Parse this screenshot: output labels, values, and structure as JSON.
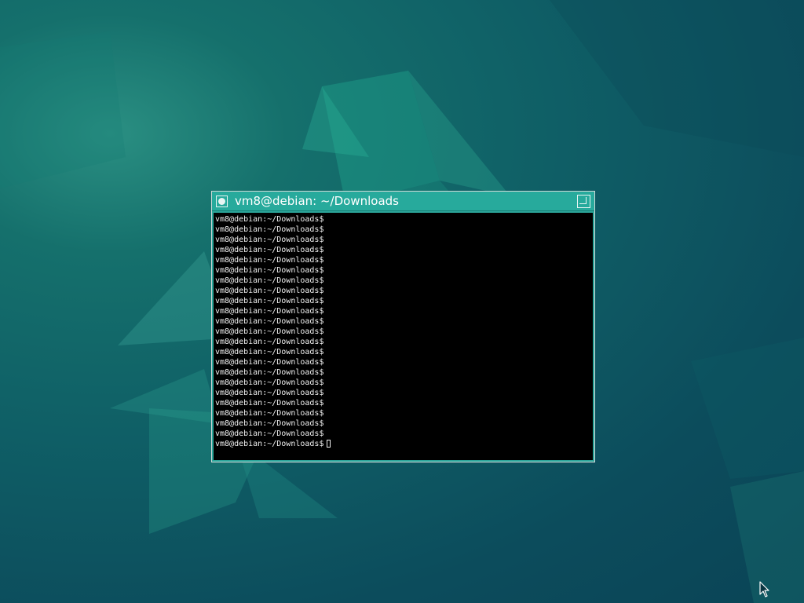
{
  "window": {
    "title": "vm8@debian: ~/Downloads"
  },
  "terminal": {
    "lines": [
      "vm8@debian:~/Downloads$",
      "vm8@debian:~/Downloads$",
      "vm8@debian:~/Downloads$",
      "vm8@debian:~/Downloads$",
      "vm8@debian:~/Downloads$",
      "vm8@debian:~/Downloads$",
      "vm8@debian:~/Downloads$",
      "vm8@debian:~/Downloads$",
      "vm8@debian:~/Downloads$",
      "vm8@debian:~/Downloads$",
      "vm8@debian:~/Downloads$",
      "vm8@debian:~/Downloads$",
      "vm8@debian:~/Downloads$",
      "vm8@debian:~/Downloads$",
      "vm8@debian:~/Downloads$",
      "vm8@debian:~/Downloads$",
      "vm8@debian:~/Downloads$",
      "vm8@debian:~/Downloads$",
      "vm8@debian:~/Downloads$",
      "vm8@debian:~/Downloads$",
      "vm8@debian:~/Downloads$",
      "vm8@debian:~/Downloads$"
    ],
    "prompt": "vm8@debian:~/Downloads$"
  },
  "icons": {
    "window_menu": "window-menu-icon",
    "maximize": "maximize-icon",
    "pointer": "mouse-pointer-icon"
  },
  "colors": {
    "titlebar": "#27aa9c",
    "terminal_bg": "#000000",
    "terminal_fg": "#f2f2f2",
    "desktop": "#0f5f66"
  }
}
